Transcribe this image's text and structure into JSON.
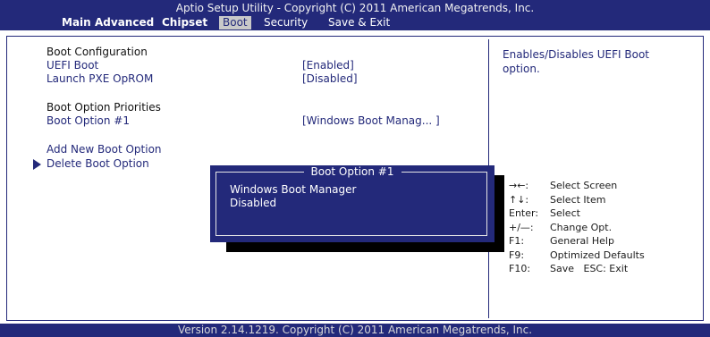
{
  "header": {
    "title": "Aptio Setup Utility - Copyright (C) 2011 American Megatrends, Inc.",
    "tabs": [
      "Main",
      "Advanced",
      "Chipset",
      "Boot",
      "Security",
      "Save & Exit"
    ],
    "active_tab": "Boot"
  },
  "settings": {
    "boot_configuration": "Boot Configuration",
    "uefi_boot": {
      "label": "UEFI Boot",
      "value": "[Enabled]"
    },
    "launch_pxe": {
      "label": "Launch PXE OpROM",
      "value": "[Disabled]"
    },
    "boot_option_priorities": "Boot Option Priorities",
    "boot_option_1": {
      "label": "Boot Option #1",
      "value": "[Windows Boot Manag... ]"
    },
    "add_new_boot_option": "Add New Boot Option",
    "delete_boot_option": "Delete Boot Option"
  },
  "popup": {
    "title": "Boot Option #1",
    "options": [
      "Windows Boot Manager",
      "Disabled"
    ]
  },
  "help": {
    "text": "Enables/Disables UEFI Boot option.",
    "keys": [
      {
        "key": "→←:",
        "desc": "Select Screen"
      },
      {
        "key": "↑↓:",
        "desc": "Select Item"
      },
      {
        "key": "Enter:",
        "desc": "Select"
      },
      {
        "key": "+/—:",
        "desc": "Change Opt."
      },
      {
        "key": "F1:",
        "desc": "General Help"
      },
      {
        "key": "F9:",
        "desc": "Optimized Defaults"
      },
      {
        "key": "F10:",
        "desc": "Save   ESC: Exit"
      }
    ]
  },
  "footer": "Version 2.14.1219. Copyright (C) 2011 American Megatrends, Inc.",
  "colors": {
    "bios_blue": "#23297a",
    "highlight": "#c9c9c9"
  }
}
